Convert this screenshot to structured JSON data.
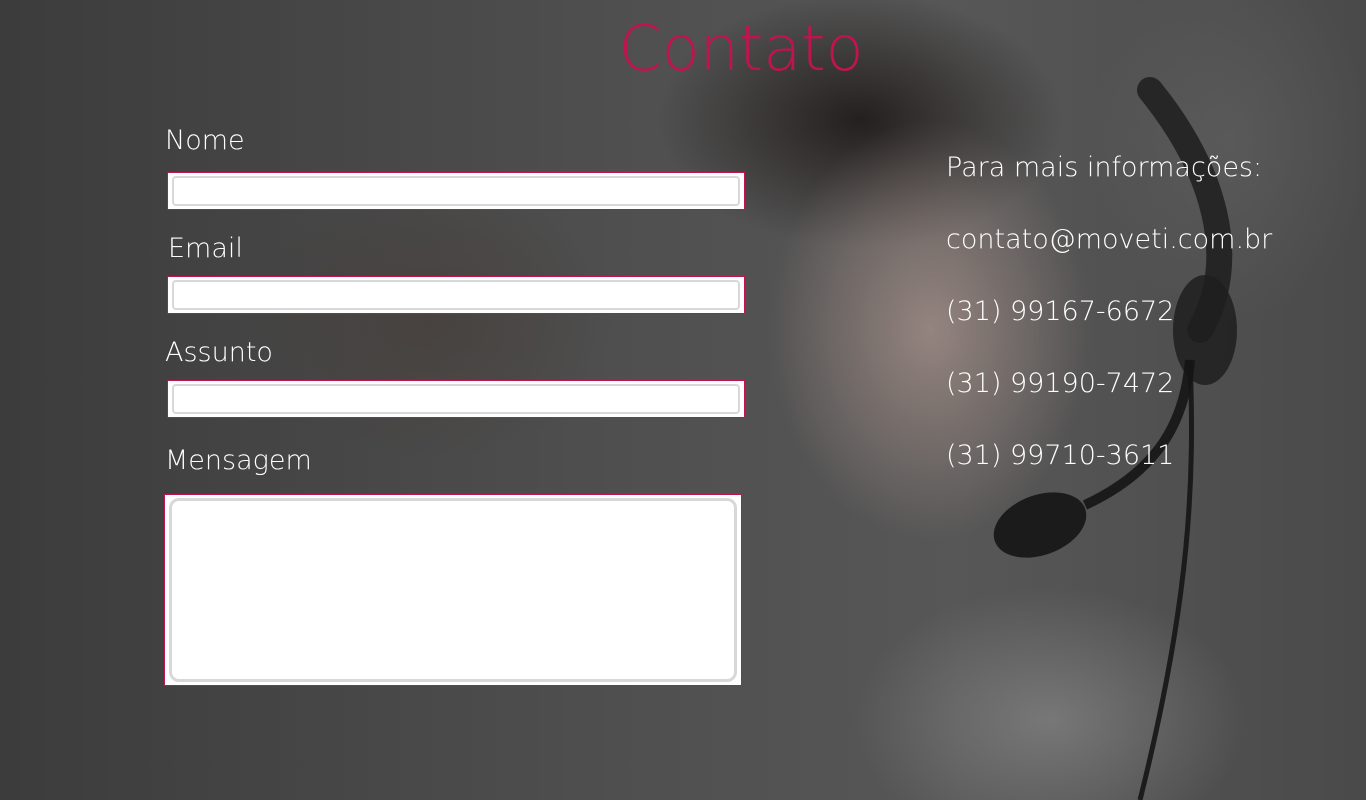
{
  "page": {
    "title": "Contato",
    "title_color": "#c0144f",
    "accent_border_color": "#c0144f"
  },
  "form": {
    "name_label": "Nome",
    "name_value": "",
    "email_label": "Email",
    "email_value": "",
    "subject_label": "Assunto",
    "subject_value": "",
    "message_label": "Mensagem",
    "message_value": ""
  },
  "contact_info": {
    "heading": "Para mais informações:",
    "email": "contato@moveti.com.br",
    "phones": [
      "(31) 99167-6672",
      "(31) 99190-7472",
      "(31) 99710-3611"
    ]
  }
}
